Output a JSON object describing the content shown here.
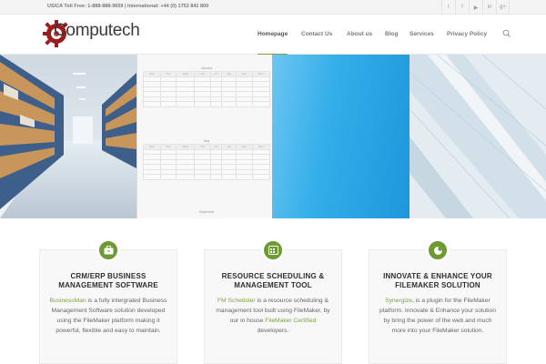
{
  "topbar": {
    "phone": "US/CA Toll Free: 1-888-888-9659 | International: +44 (0) 1752 841 800",
    "social": [
      {
        "icon": "twitter-icon",
        "glyph": "t"
      },
      {
        "icon": "facebook-icon",
        "glyph": "f"
      },
      {
        "icon": "youtube-icon",
        "glyph": "▶"
      },
      {
        "icon": "linkedin-icon",
        "glyph": "in"
      },
      {
        "icon": "googleplus-icon",
        "glyph": "g+"
      }
    ]
  },
  "header": {
    "logo_text": "Computech",
    "nav": [
      {
        "label": "Homepage",
        "active": true
      },
      {
        "label": "Contact Us",
        "active": false
      },
      {
        "label": "About us",
        "active": false
      },
      {
        "label": "Blog",
        "active": false
      },
      {
        "label": "Services",
        "active": false
      },
      {
        "label": "Privacy Policy",
        "active": false
      }
    ]
  },
  "colors": {
    "accent": "#7aa33c",
    "badge": "#6e9a33",
    "logo_red": "#9b1c1c"
  },
  "hero": {
    "calendar": {
      "months": [
        "January",
        "May",
        "September"
      ],
      "days": [
        "Mon",
        "Tue",
        "Wed",
        "Thu",
        "Fri",
        "Sat",
        "Sun",
        "Mon"
      ]
    }
  },
  "cards": [
    {
      "icon": "briefcase-icon",
      "title_line1": "CRM/ERP BUSINESS",
      "title_line2": "MANAGEMENT SOFTWARE",
      "link": "BusinessMan",
      "text": " is a fully intergrated Business Management Software solution developed using the FileMaker platform making it powerful, flexible and easy to maintain.",
      "link2": "",
      "text2": ""
    },
    {
      "icon": "calendar-icon",
      "title_line1": "RESOURCE SCHEDULING &",
      "title_line2": "MANAGEMENT TOOL",
      "link": "FM Scheduler",
      "text": " is a resource scheduling & management tool built using FileMaker, by our in house ",
      "link2": "FileMaker Certified",
      "text2": " developers."
    },
    {
      "icon": "pie-chart-icon",
      "title_line1": "INNOVATE & ENHANCE YOUR",
      "title_line2": "FILEMAKER SOLUTION",
      "link": "Synergize",
      "text": ", is a plugin for the FileMaker platform.  Innovate & Enhance  your solution by bring the power of the web and much more into your FileMaker solution.",
      "link2": "",
      "text2": ""
    }
  ]
}
